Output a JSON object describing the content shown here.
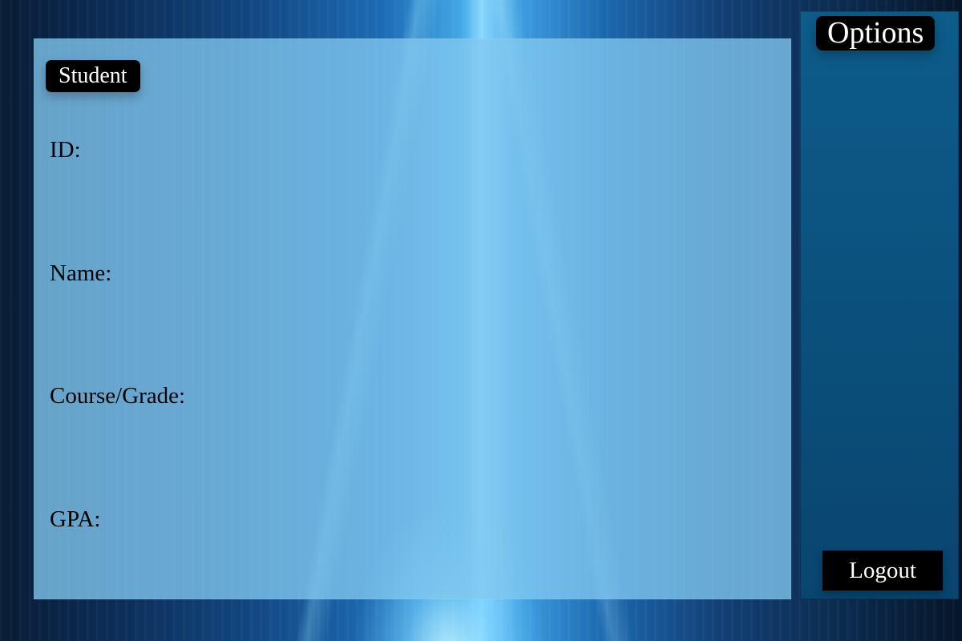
{
  "main_panel": {
    "section_label": "Student",
    "fields": {
      "id_label": "ID:",
      "name_label": "Name:",
      "course_grade_label": "Course/Grade:",
      "gpa_label": "GPA:"
    }
  },
  "sidebar": {
    "title": "Options",
    "logout_label": "Logout"
  },
  "theme": {
    "panel_color": "#82c8f0",
    "sidebar_color": "#0d5c8b",
    "badge_color": "#000000",
    "text_color": "#000000"
  }
}
